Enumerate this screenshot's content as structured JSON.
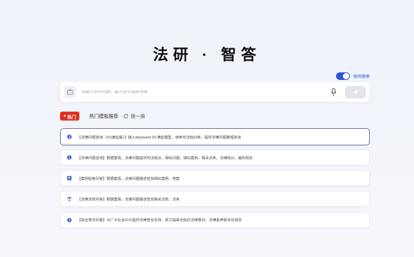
{
  "header": {
    "title": "法研 · 智答"
  },
  "web_search": {
    "label": "联网搜索",
    "enabled": true
  },
  "search": {
    "placeholder": "请输入你的问题，输入@可选择场景"
  },
  "tabs": {
    "hot_label": "热门",
    "templates_label": "热门模板推荐",
    "refresh_label": "换一换"
  },
  "templates": [
    {
      "text": "【法律问题咨询（DS满血版）】接入deepseek R1满血模型，使用司法知识库，提供法律问题推理咨询",
      "icon": "info-circle-icon",
      "selected": true
    },
    {
      "text": "【法律问题咨询】根据案情，法律问题提供判决观点，相似问题，相似案例，相关法条，法律知识，裁判规定",
      "icon": "info-circle-icon",
      "selected": false
    },
    {
      "text": "【案例检索问答】根据案情，法律问题描述查找相似案例、类案",
      "icon": "document-icon",
      "selected": false
    },
    {
      "text": "【法律法规问答】根据案情，法律问题描述查找相关法规、法条",
      "icon": "scales-icon",
      "selected": false
    },
    {
      "text": "【综合普法问答】为广大社会公众提供法律普及支持，助力提高全民的法律意识，法律素养和法治观念",
      "icon": "info-circle-icon",
      "selected": false
    }
  ],
  "colors": {
    "accent": "#2f55d4",
    "hot": "#e0301e"
  }
}
